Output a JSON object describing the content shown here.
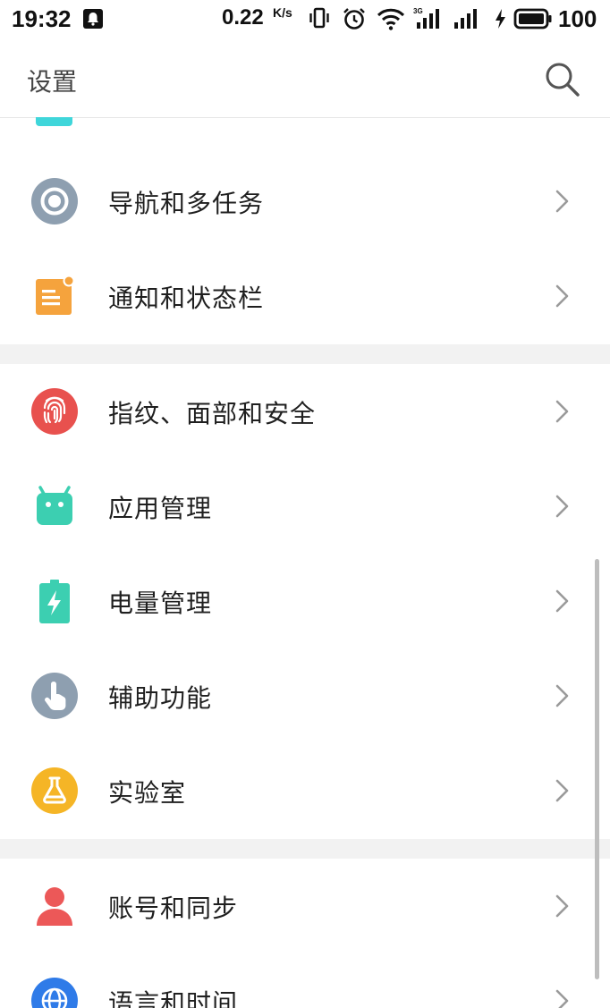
{
  "status_bar": {
    "time": "19:32",
    "speed": "0.22",
    "speed_unit": "K/s",
    "battery": "100"
  },
  "header": {
    "title": "设置"
  },
  "sections": [
    {
      "items": [
        {
          "label": "导航和多任务",
          "icon": "navigation-icon",
          "color": "#8e9fb0"
        },
        {
          "label": "通知和状态栏",
          "icon": "notification-icon",
          "color": "#f5a33d"
        }
      ]
    },
    {
      "items": [
        {
          "label": "指纹、面部和安全",
          "icon": "fingerprint-icon",
          "color": "#e8514e"
        },
        {
          "label": "应用管理",
          "icon": "android-icon",
          "color": "#3ccfb1"
        },
        {
          "label": "电量管理",
          "icon": "battery-icon",
          "color": "#3ccfb1"
        },
        {
          "label": "辅助功能",
          "icon": "hand-icon",
          "color": "#8e9fb0"
        },
        {
          "label": "实验室",
          "icon": "flask-icon",
          "color": "#f5b526"
        }
      ]
    },
    {
      "items": [
        {
          "label": "账号和同步",
          "icon": "account-icon",
          "color": "#ec5858"
        },
        {
          "label": "语言和时间",
          "icon": "globe-icon",
          "color": "#2f7be8"
        }
      ]
    }
  ]
}
